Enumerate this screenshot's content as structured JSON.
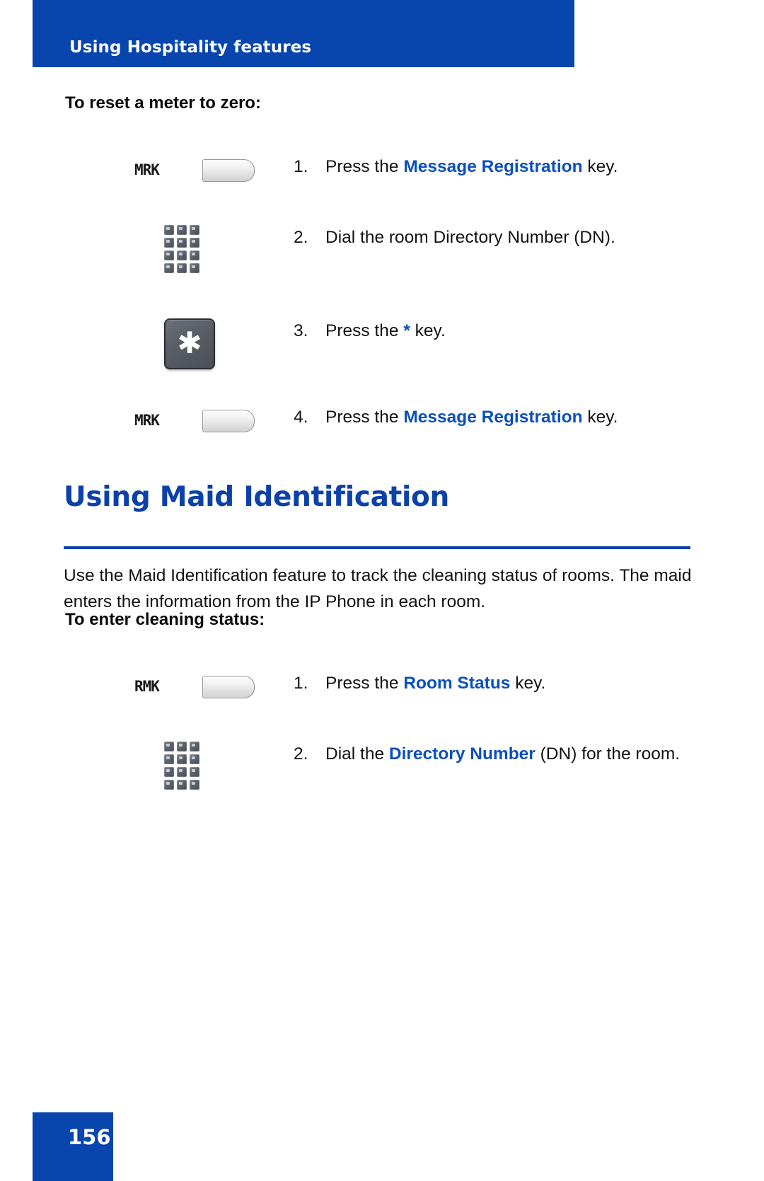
{
  "page": {
    "running_head": "Using Hospitality features",
    "number": "156",
    "accent_blue": "#0846AD",
    "link_blue": "#0B4FBC"
  },
  "sections": [
    {
      "subhead": "To reset a meter to zero:",
      "steps": [
        {
          "num": "1.",
          "icon": "feature-key",
          "key_label": "MRK",
          "text_before": "Press the ",
          "highlight": "Message Registration",
          "text_after": " key."
        },
        {
          "num": "2.",
          "icon": "keypad",
          "key_label": "",
          "text_before": "Dial the room Directory Number (DN).",
          "highlight": "",
          "text_after": ""
        },
        {
          "num": "3.",
          "icon": "star-key",
          "key_label": "*",
          "text_before": "Press the ",
          "highlight": "*",
          "text_after": " key."
        },
        {
          "num": "4.",
          "icon": "feature-key",
          "key_label": "MRK",
          "text_before": "Press the ",
          "highlight": "Message Registration",
          "text_after": " key."
        }
      ]
    }
  ],
  "maid_section": {
    "heading": "Using Maid Identification",
    "paragraph": "Use the Maid Identification feature to track the cleaning status of rooms. The maid enters the information from the IP Phone in each room.",
    "subhead": "To enter cleaning status:",
    "steps": [
      {
        "num": "1.",
        "icon": "feature-key",
        "key_label": "RMK",
        "text_before": "Press the ",
        "highlight": "Room Status",
        "text_after": " key."
      },
      {
        "num": "2.",
        "icon": "keypad",
        "key_label": "",
        "text_before": "Dial the ",
        "highlight": "Directory Number",
        "text_after": " (DN) for the room."
      }
    ]
  }
}
